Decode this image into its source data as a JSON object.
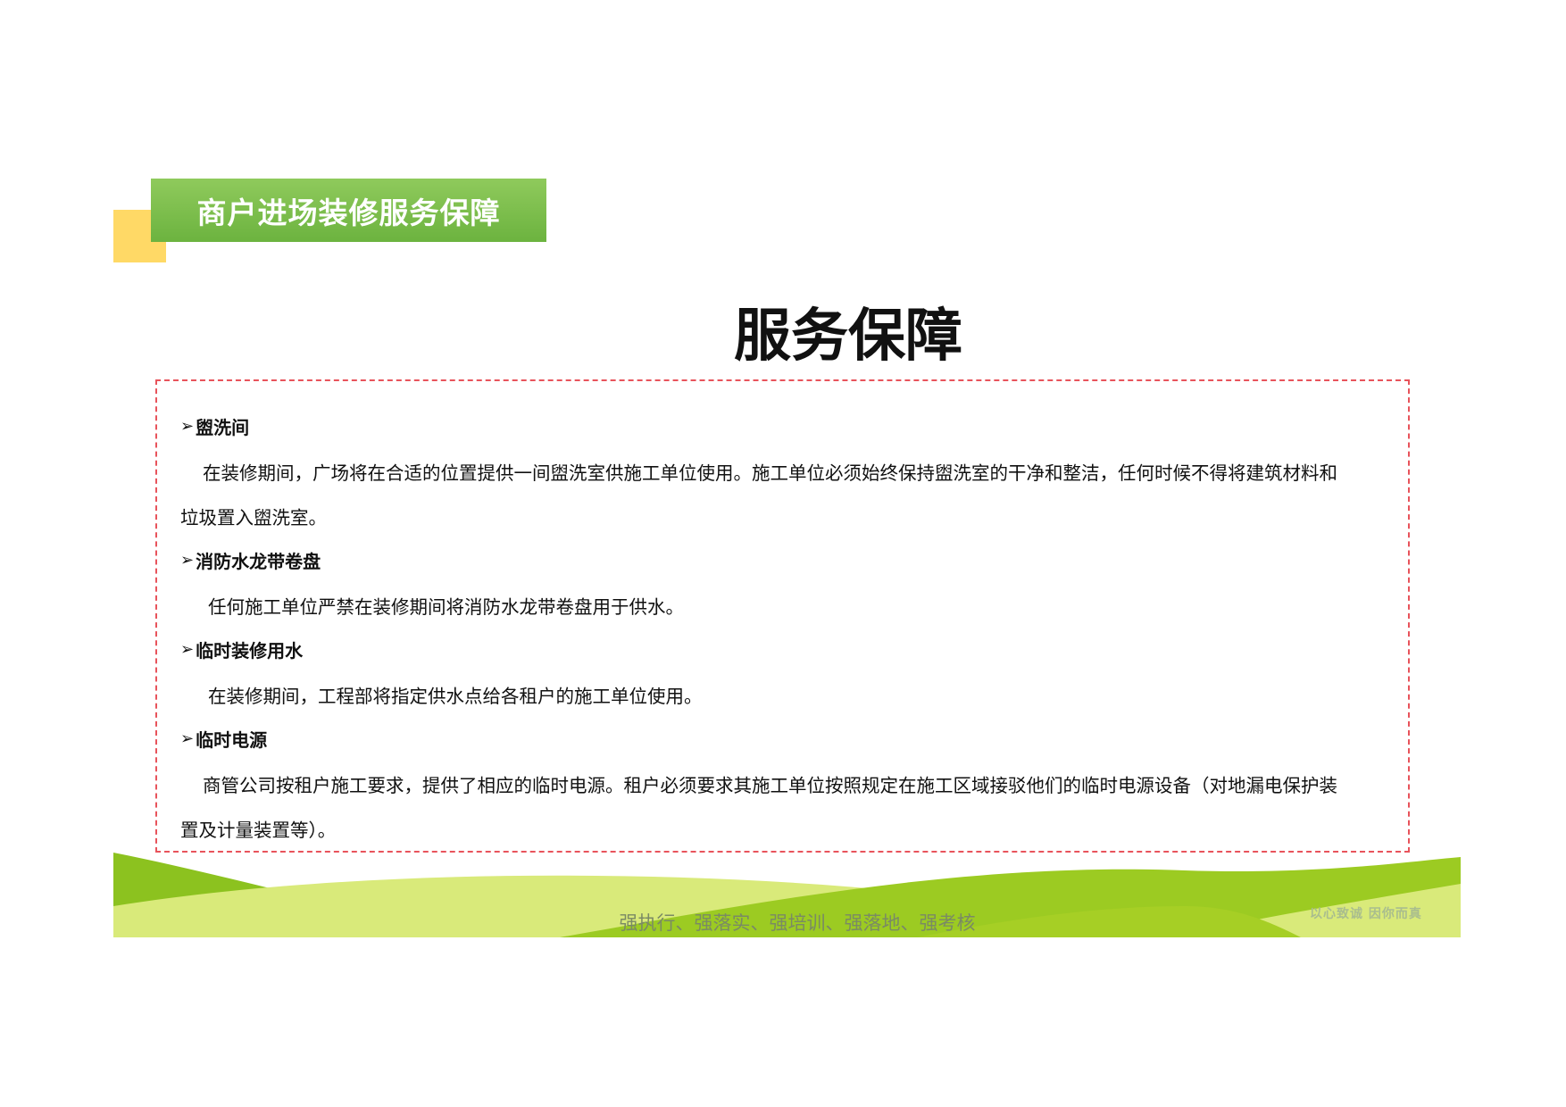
{
  "header": {
    "title": "商户进场装修服务保障"
  },
  "page_title": "服务保障",
  "sections": [
    {
      "arrow": "➢",
      "heading": "盥洗间",
      "lines": [
        "在装修期间，广场将在合适的位置提供一间盥洗室供施工单位使用。施工单位必须始终保持盥洗室的干净和整洁，任何时候不得将建筑材料和",
        "垃圾置入盥洗室。"
      ]
    },
    {
      "arrow": "➢",
      "heading": "消防水龙带卷盘",
      "lines": [
        "任何施工单位严禁在装修期间将消防水龙带卷盘用于供水。"
      ]
    },
    {
      "arrow": "➢",
      "heading": "临时装修用水",
      "lines": [
        "在装修期间，工程部将指定供水点给各租户的施工单位使用。"
      ]
    },
    {
      "arrow": "➢",
      "heading": "临时电源",
      "lines": [
        "商管公司按租户施工要求，提供了相应的临时电源。租户必须要求其施工单位按照规定在施工区域接驳他们的临时电源设备（对地漏电保护装",
        "置及计量装置等）。"
      ]
    }
  ],
  "footer": {
    "slogan": "强执行、强落实、强培训、强落地、强考核",
    "brand": "以心致诚  因你而真"
  },
  "colors": {
    "header_green": "#6cb33f",
    "accent_yellow": "#ffd966",
    "border_red": "#e8535b",
    "wave_green": "#8cc21f",
    "wave_light": "#d9ea7a"
  }
}
